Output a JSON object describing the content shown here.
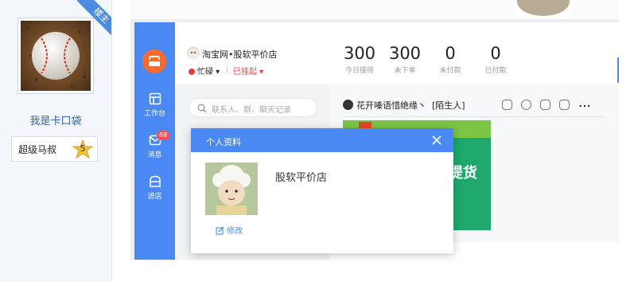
{
  "post": {
    "corner_tag": "楼主",
    "username": "我是卡口袋",
    "level_name": "超级马叔",
    "level_number": "5"
  },
  "screenshot": {
    "shop_name": "淘宝网•股软平价店",
    "status_busy": "忙碌",
    "status_hung": "已挂起",
    "stats": [
      {
        "value": "300",
        "label": "今日接待"
      },
      {
        "value": "300",
        "label": "未下单"
      },
      {
        "value": "0",
        "label": "未付款"
      },
      {
        "value": "0",
        "label": "已付款"
      }
    ],
    "nav": [
      {
        "label": "工作台",
        "icon": "workbench-icon"
      },
      {
        "label": "消息",
        "icon": "message-icon",
        "badge": "68"
      },
      {
        "label": "进店",
        "icon": "store-icon"
      }
    ],
    "search_placeholder": "联系人、群、聊天记录",
    "chat_title": "花开嗪语惜绝缘丶",
    "chat_tag": "[陌生人]",
    "banner_text": "提货",
    "dialog": {
      "title": "个人资料",
      "name": "股软平价店",
      "edit_label": "修改"
    }
  }
}
